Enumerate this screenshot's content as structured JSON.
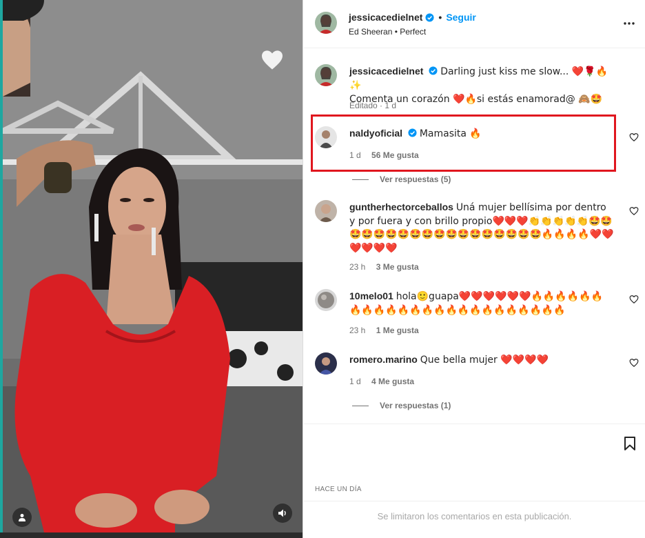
{
  "post": {
    "username": "jessicacedielnet",
    "follow_label": "Seguir",
    "audio": "Ed Sheeran • Perfect",
    "caption_line1": "Darling just kiss me slow... ❤️🌹🔥✨",
    "caption_line2": "Comenta un corazón ❤️🔥si estás enamorad@ 🙈🤩",
    "edited": "Editado · 1 d"
  },
  "comments": [
    {
      "username": "naldyoficial",
      "text": "Mamasita 🔥",
      "time": "1 d",
      "likes": "56 Me gusta",
      "replies": "Ver respuestas (5)"
    },
    {
      "username": "guntherhectorceballos",
      "text": "Uná mujer bellísima por dentro y por fuera y con brillo propio❤️❤️❤️👏👏👏👏👏🤩🤩🤩🤩🤩🤩🤩🤩🤩🤩🤩🤩🤩🤩🤩🤩🤩🤩🔥🔥🔥🔥❤️❤️❤️❤️❤️❤️",
      "time": "23 h",
      "likes": "3 Me gusta"
    },
    {
      "username": "10melo01",
      "text": "hola🙂guapa❤️❤️❤️❤️❤️❤️🔥🔥🔥🔥🔥🔥🔥🔥🔥🔥🔥🔥🔥🔥🔥🔥🔥🔥🔥🔥🔥🔥🔥🔥",
      "time": "23 h",
      "likes": "1 Me gusta"
    },
    {
      "username": "romero.marino",
      "text": "Que bella mujer ❤️❤️❤️❤️",
      "time": "1 d",
      "likes": "4 Me gusta",
      "replies": "Ver respuestas (1)"
    }
  ],
  "footer": {
    "date": "HACE UN DÍA",
    "limited": "Se limitaron los comentarios en esta publicación."
  },
  "icons": {
    "heart_overlay": "heart-icon",
    "more": "more-options-icon",
    "bookmark": "bookmark-icon",
    "verified": "verified-badge-icon",
    "user_tag": "user-tag-icon",
    "audio": "speaker-icon",
    "comment_like": "heart-outline-icon"
  },
  "colors": {
    "link_blue": "#0095f6",
    "highlight_red": "#e0161e",
    "dress_red": "#d91f24"
  }
}
